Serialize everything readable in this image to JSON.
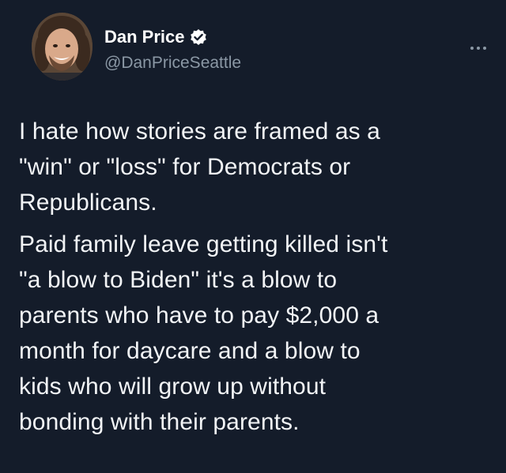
{
  "author": {
    "display_name": "Dan Price",
    "handle": "@DanPriceSeattle",
    "verified": true
  },
  "icons": {
    "verified": "verified-badge-icon",
    "more": "more-horizontal-icon"
  },
  "colors": {
    "background": "#141c2a",
    "text": "#f2f4f6",
    "secondary_text": "#8b98a5",
    "verified": "#ffffff"
  },
  "tweet": {
    "paragraphs": [
      "I hate how stories are framed as a\n\"win\" or \"loss\" for Democrats or\nRepublicans.",
      "Paid family leave getting killed isn't\n\"a blow to Biden\" it's a blow to\nparents who have to pay $2,000 a\nmonth for daycare and a blow to\nkids who will grow up without\nbonding with their parents."
    ]
  }
}
